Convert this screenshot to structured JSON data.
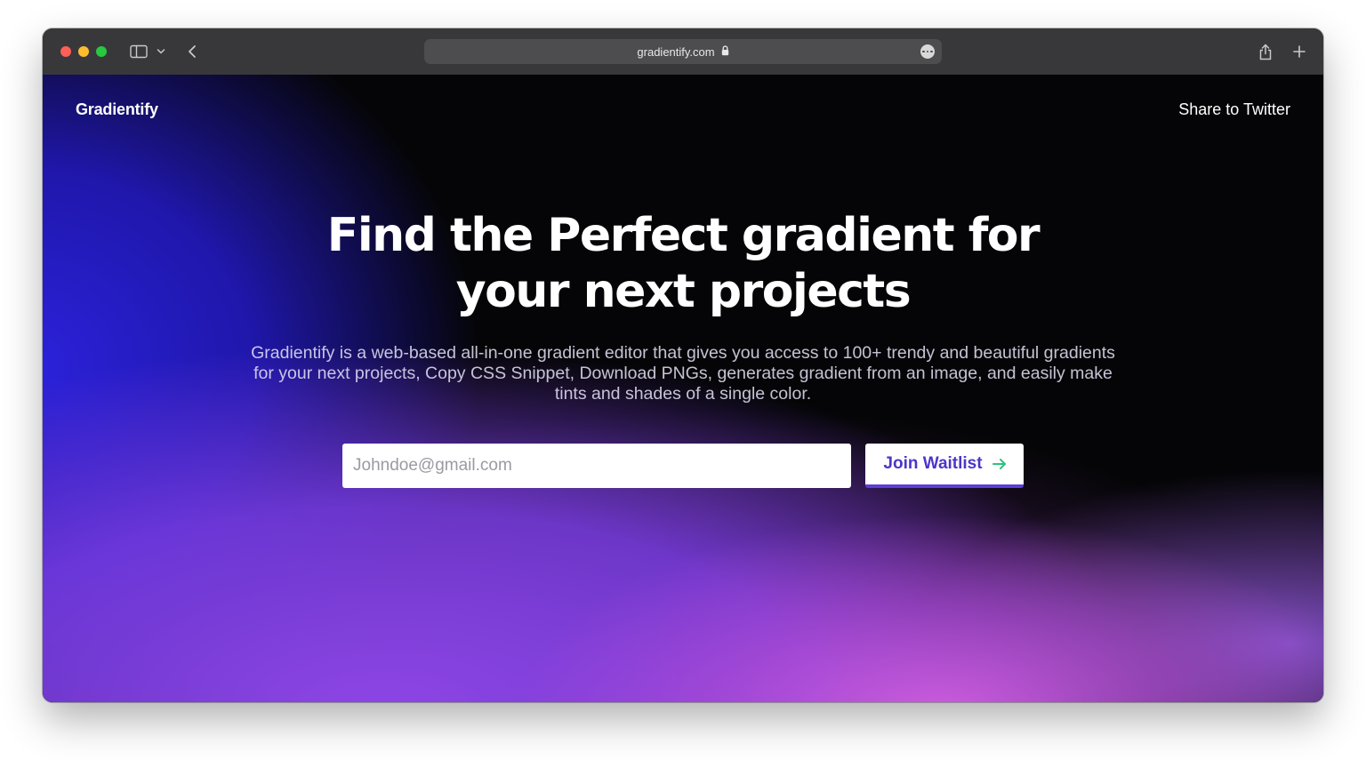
{
  "browser": {
    "url": "gradientify.com",
    "icons": {
      "sidebar": "sidebar-icon",
      "chevron": "chevron-down-icon",
      "back": "back-icon",
      "lock": "lock-icon",
      "more": "more-icon",
      "share": "share-icon",
      "new_tab": "plus-icon"
    }
  },
  "header": {
    "brand": "Gradientify",
    "twitter_link": "Share to Twitter"
  },
  "hero": {
    "title_line1": "Find the Perfect gradient for",
    "title_line2": "your next projects",
    "description": "Gradientify is a web-based all-in-one gradient editor that gives you access to 100+ trendy and beautiful gradients for your next projects, Copy CSS Snippet, Download PNGs, generates gradient from an image, and easily make tints and shades of a single color."
  },
  "waitlist": {
    "email_placeholder": "Johndoe@gmail.com",
    "email_value": "",
    "button_label": "Join Waitlist",
    "button_icon": "arrow-right-icon"
  },
  "colors": {
    "button_text": "#4b36c9",
    "arrow": "#2ec27e",
    "button_underline": "#5b3fd8",
    "toolbar_bg": "#38383a"
  }
}
